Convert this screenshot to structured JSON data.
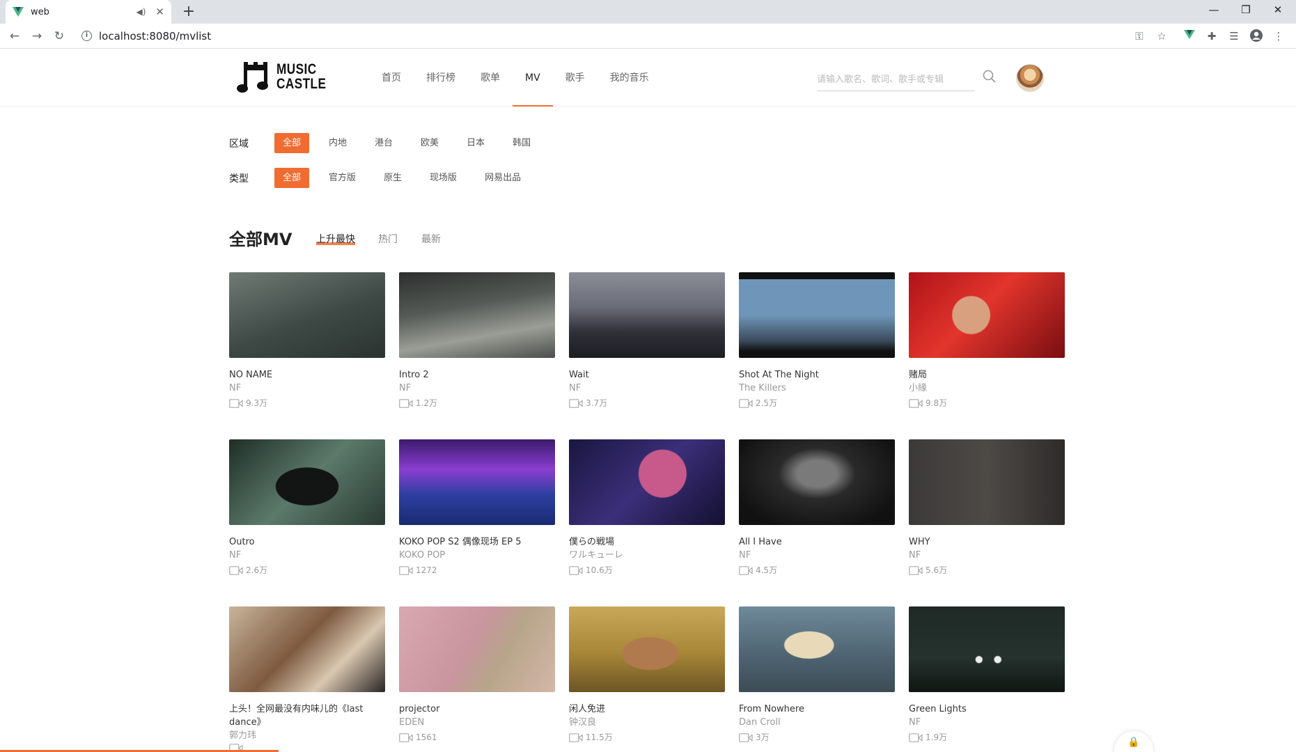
{
  "browser": {
    "tab_title": "web",
    "url": "localhost:8080/mvlist"
  },
  "site": {
    "logo_line1": "MUSIC",
    "logo_line2": "CASTLE",
    "nav": [
      {
        "label": "首页"
      },
      {
        "label": "排行榜"
      },
      {
        "label": "歌单"
      },
      {
        "label": "MV",
        "active": true
      },
      {
        "label": "歌手"
      },
      {
        "label": "我的音乐"
      }
    ],
    "search_placeholder": "请输入歌名、歌词、歌手或专辑"
  },
  "filters": {
    "area_label": "区域",
    "areas": [
      "全部",
      "内地",
      "港台",
      "欧美",
      "日本",
      "韩国"
    ],
    "type_label": "类型",
    "types": [
      "全部",
      "官方版",
      "原生",
      "现场版",
      "网易出品"
    ]
  },
  "section": {
    "title": "全部MV",
    "sorts": [
      "上升最快",
      "热门",
      "最新"
    ]
  },
  "accent": "#f16c31",
  "mvs": [
    {
      "title": "NO NAME",
      "artist": "NF",
      "plays": "9.3万",
      "bg": "linear-gradient(160deg,#6f7a75 0%,#3e4945 55%,#2a3330 100%)"
    },
    {
      "title": "Intro 2",
      "artist": "NF",
      "plays": "1.2万",
      "bg": "linear-gradient(170deg,#2c2f2e 0%,#555a56 40%,#9a9e96 70%,#4b4f4a 100%)"
    },
    {
      "title": "Wait",
      "artist": "NF",
      "plays": "3.7万",
      "bg": "linear-gradient(180deg,#8a8d96 0%,#6b6d78 40%,#2f3038 70%,#1d1e24 100%)"
    },
    {
      "title": "Shot At The Night",
      "artist": "The Killers",
      "plays": "2.5万",
      "bg": "linear-gradient(180deg,#111 0 8%,#6f96b9 8% 50%,#3a4b5c 80%,#111 92%)"
    },
    {
      "title": "赌局",
      "artist": "小緣",
      "plays": "9.8万",
      "bg": "radial-gradient(circle at 40% 50%,#d9a080 0 18%,transparent 19%),linear-gradient(135deg,#b0131a 0%,#e2352c 45%,#7a0d12 100%)"
    },
    {
      "title": "Outro",
      "artist": "NF",
      "plays": "2.6万",
      "bg": "radial-gradient(ellipse at 50% 55%,#121513 0 28%,transparent 29%),linear-gradient(135deg,#1f2e27 0%,#5b7a6a 50%,#2a3a32 100%)"
    },
    {
      "title": "KOKO POP S2 偶像现场 EP 5",
      "artist": "KOKO POP",
      "plays": "1272",
      "bg": "linear-gradient(180deg,#3a1a6b 0%,#8a3ed0 35%,#2c3fa0 65%,#1a2a70 100%)"
    },
    {
      "title": "僕らの戦場",
      "artist": "ワルキューレ",
      "plays": "10.6万",
      "bg": "radial-gradient(circle at 60% 40%,#c75a8a 0 22%,transparent 23%),linear-gradient(135deg,#1b1640 0%,#3b2f7a 50%,#141030 100%)"
    },
    {
      "title": "All I Have",
      "artist": "NF",
      "plays": "4.5万",
      "bg": "radial-gradient(ellipse at 50% 40%,#7a7a7a 0 18%,#2a2a2a 35%,#111 80%)"
    },
    {
      "title": "WHY",
      "artist": "NF",
      "plays": "5.6万",
      "bg": "linear-gradient(90deg,#3c3a38 0%,#4d4a46 50%,#2e2c2a 100%)"
    },
    {
      "title": "上头！全网最没有内味儿的《last dance》",
      "artist": "郭力玮",
      "plays": "",
      "bg": "linear-gradient(135deg,#c8b49a 0%,#7d5a40 45%,#d8c7b0 70%,#2a2524 100%)"
    },
    {
      "title": "projector",
      "artist": "EDEN",
      "plays": "1561",
      "bg": "linear-gradient(120deg,#d9a8b0 0%,#c9959f 45%,#b7a58a 65%,#d4b7a9 100%)"
    },
    {
      "title": "闲人免进",
      "artist": "钟汉良",
      "plays": "11.5万",
      "bg": "radial-gradient(ellipse at 52% 55%,#b07a4e 0 24%,transparent 25%),linear-gradient(180deg,#caa85a 0%,#a78638 55%,#6d5524 100%)"
    },
    {
      "title": "From Nowhere",
      "artist": "Dan Croll",
      "plays": "3万",
      "bg": "radial-gradient(ellipse at 45% 45%,#e8d9b8 0 20%,transparent 21%),linear-gradient(180deg,#6f8a9a 0%,#4d6270 60%,#3c4c56 100%)"
    },
    {
      "title": "Green Lights",
      "artist": "NF",
      "plays": "1.9万",
      "bg": "radial-gradient(circle at 45% 62%,#eee 0 3%,transparent 4%),radial-gradient(circle at 57% 62%,#eee 0 3%,transparent 4%),linear-gradient(180deg,#1f2a26 0%,#25322d 60%,#0f1512 100%)"
    }
  ]
}
